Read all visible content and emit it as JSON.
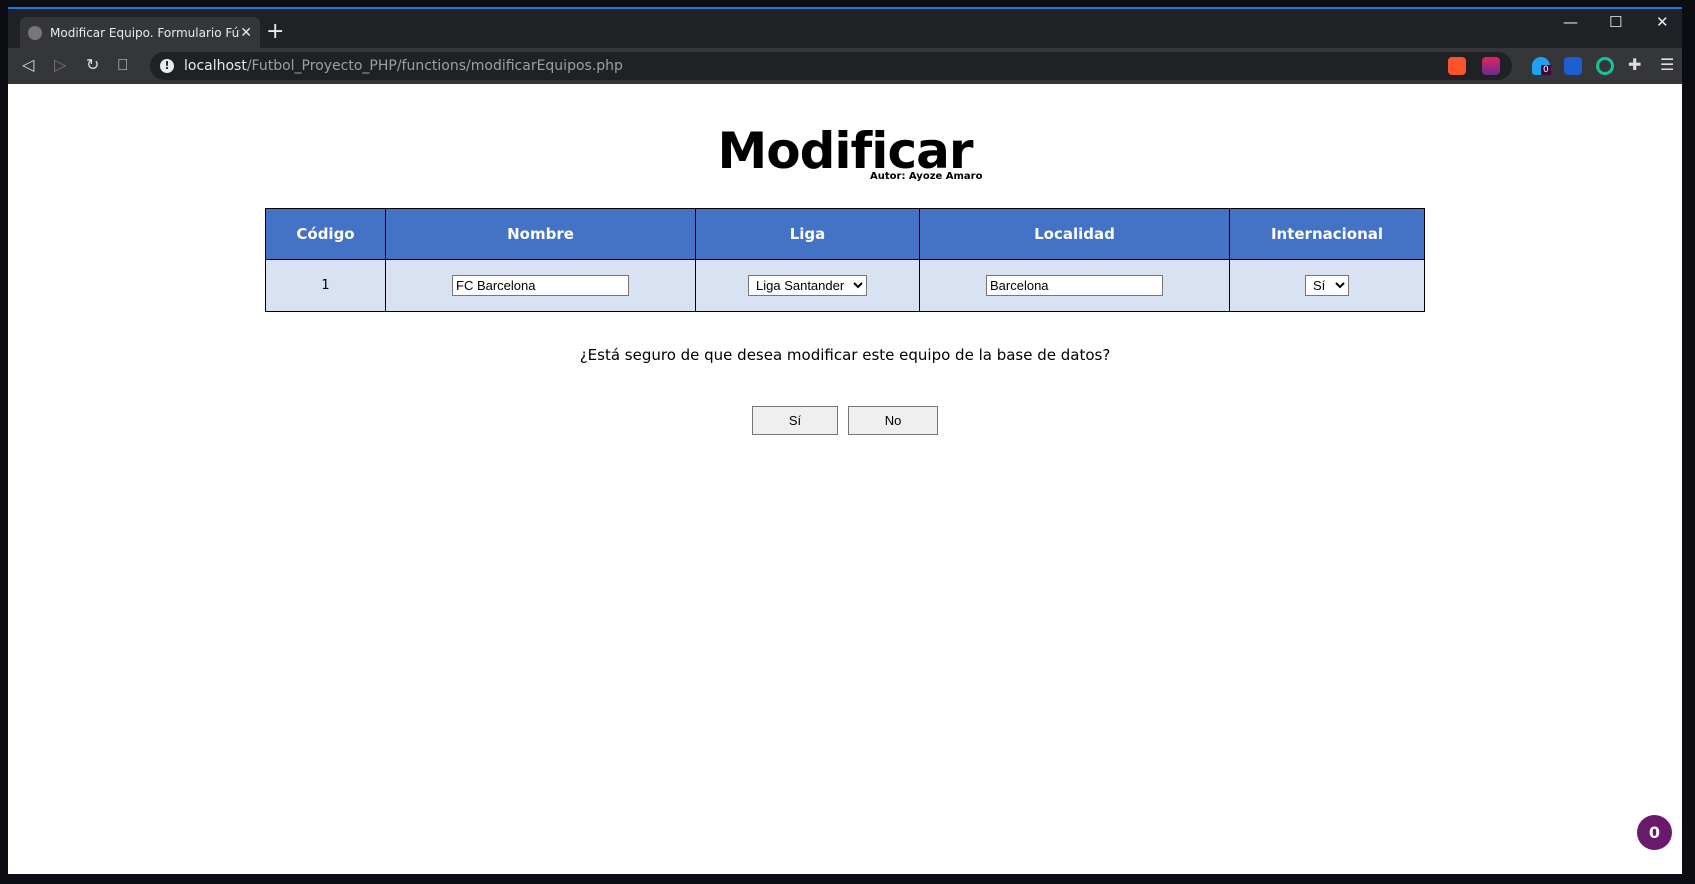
{
  "browser": {
    "tab_title": "Modificar Equipo. Formulario Fútbol",
    "url_host": "localhost",
    "url_path": "/Futbol_Proyecto_PHP/functions/modificarEquipos.php",
    "extension_badge": "0"
  },
  "page": {
    "title": "Modificar",
    "author": "Autor: Ayoze Amaro",
    "table": {
      "headers": [
        "Código",
        "Nombre",
        "Liga",
        "Localidad",
        "Internacional"
      ],
      "row": {
        "codigo": "1",
        "nombre": "FC Barcelona",
        "liga": "Liga Santander",
        "localidad": "Barcelona",
        "internacional": "Sí"
      }
    },
    "question": "¿Está seguro de que desea modificar este equipo de la base de datos?",
    "yes_label": "Sí",
    "no_label": "No",
    "notification_count": "0"
  },
  "colors": {
    "header": "#4472c4",
    "row": "#d9e2f3",
    "badge": "#6b1a6b"
  }
}
